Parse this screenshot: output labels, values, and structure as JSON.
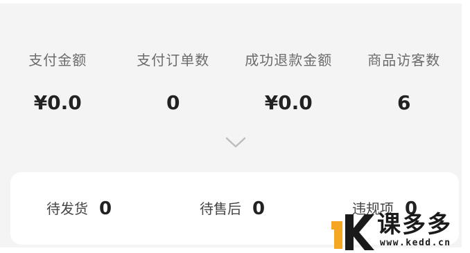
{
  "stats": [
    {
      "label": "支付金额",
      "value": "¥0.0"
    },
    {
      "label": "支付订单数",
      "value": "0"
    },
    {
      "label": "成功退款金额",
      "value": "¥0.0"
    },
    {
      "label": "商品访客数",
      "value": "6"
    }
  ],
  "expand_icon": "chevron-down-icon",
  "status_card": {
    "items": [
      {
        "label": "待发货",
        "value": "0"
      },
      {
        "label": "待售后",
        "value": "0"
      },
      {
        "label": "违规项",
        "value": "0"
      }
    ]
  },
  "watermark": {
    "brand": "课多多",
    "url": "www.kedd.cn",
    "accent_color": "#f5a623"
  }
}
